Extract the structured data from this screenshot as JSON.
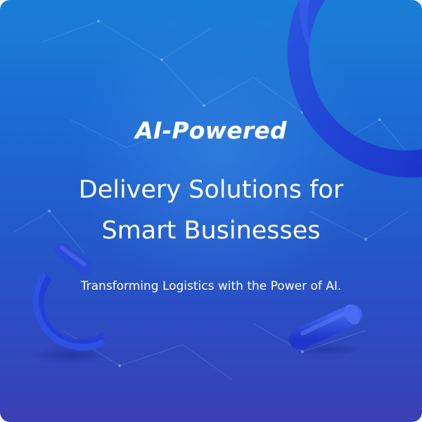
{
  "banner": {
    "headline_italic": "AI-Powered",
    "headline_line1": "Delivery Solutions for",
    "headline_line2": "Smart Businesses",
    "subtitle": "Transforming Logistics with the Power of AI."
  },
  "decorations": {
    "icons": [
      "ring-shape-icon",
      "arc-shape-icon",
      "cylinder-shape-icon",
      "network-lines-icon"
    ]
  },
  "colors": {
    "background_top": "#1a7fd6",
    "background_bottom": "#3a3fb5",
    "shape_blue": "#1f3fd8",
    "text": "#ffffff"
  }
}
